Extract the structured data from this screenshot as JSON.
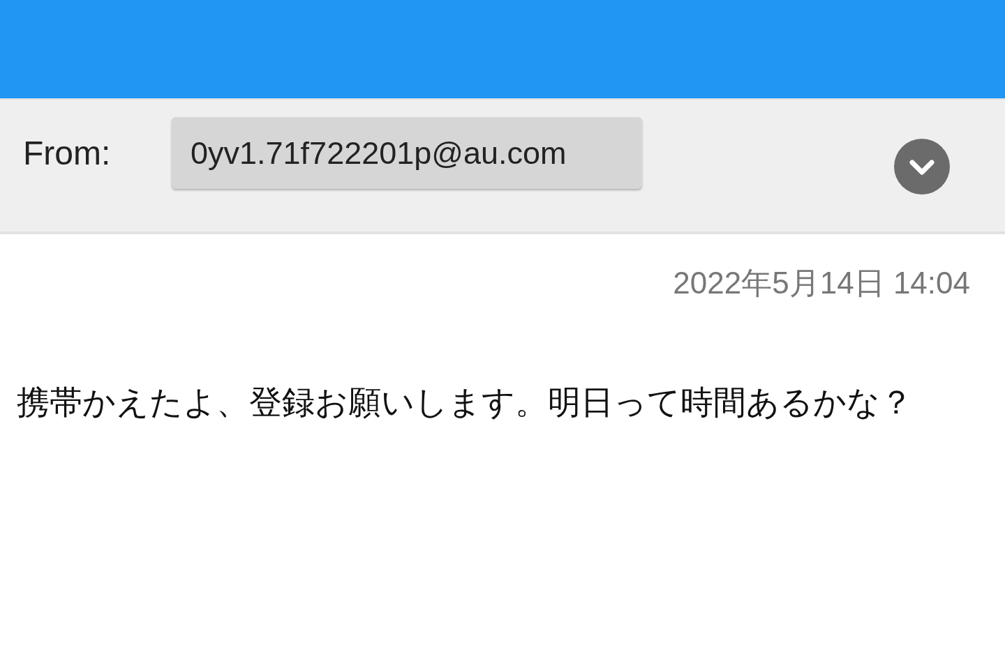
{
  "header": {
    "from_label": "From:",
    "from_address": "0yv1.71f722201p@au.com"
  },
  "message": {
    "date": "2022年5月14日 14:04",
    "body": "携帯かえたよ、登録お願いします。明日って時間あるかな？"
  }
}
